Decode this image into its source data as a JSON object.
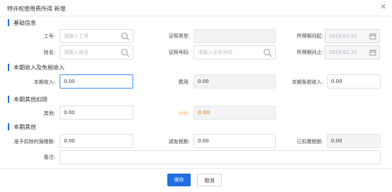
{
  "title": "特许权使用费所得 新增",
  "sections": {
    "basic": "基础信息",
    "income": "本期收入及免税收入",
    "deduct": "本期其他扣除",
    "other": "本期其他"
  },
  "fields": {
    "emp_no": {
      "label": "工号:",
      "placeholder": "请输入工号"
    },
    "cert_type": {
      "label": "证照类型:"
    },
    "period_start": {
      "label": "所得期间起:",
      "value": "2019.01.01"
    },
    "name": {
      "label": "姓名:",
      "placeholder": "请输入姓名"
    },
    "cert_no": {
      "label": "证照号码:",
      "placeholder": "请输入证照号码"
    },
    "period_end": {
      "label": "所得期间止:",
      "value": "2019.01.31"
    },
    "income": {
      "label": "本期收入:",
      "value": "0.00"
    },
    "expense": {
      "label": "费用:",
      "value": "0.00"
    },
    "tax_free": {
      "label": "本期免税收入:",
      "value": "0.00"
    },
    "other_deduct": {
      "label": "其他:",
      "value": "0.00"
    },
    "subtotal": {
      "label": "小计:",
      "value": "0.00"
    },
    "donation": {
      "label": "准予扣除的捐赠额:",
      "value": "0.00"
    },
    "tax_reduction": {
      "label": "减免税额:",
      "value": "0.00"
    },
    "withheld": {
      "label": "已扣缴税额:",
      "value": "0.00"
    },
    "remark": {
      "label": "备注:"
    }
  },
  "buttons": {
    "save": "保存",
    "cancel": "取消"
  },
  "icons": {
    "search": "search-icon",
    "calendar": "calendar-icon",
    "close": "close-icon"
  },
  "colors": {
    "accent": "#1f6fe0",
    "subtotal": "#f0a04b"
  }
}
